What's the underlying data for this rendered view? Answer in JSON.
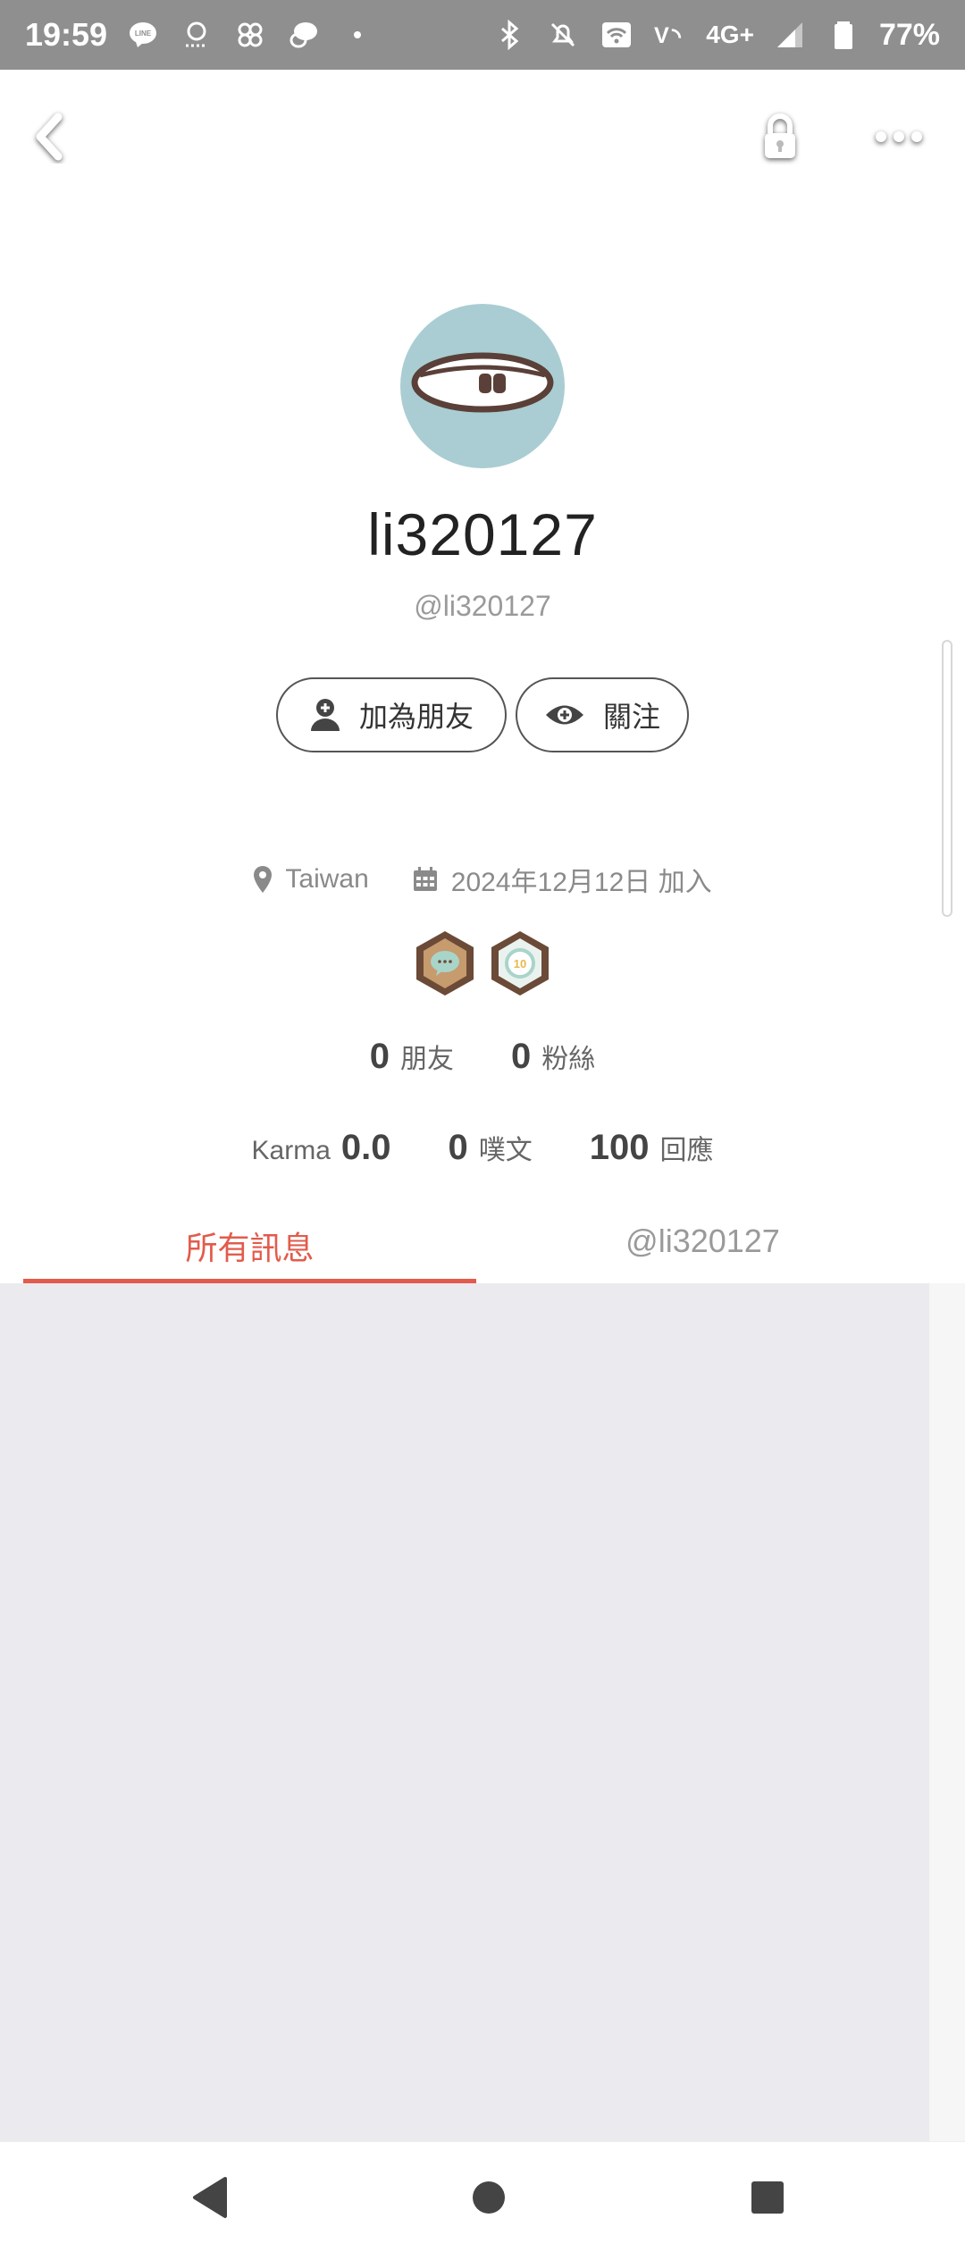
{
  "status_bar": {
    "time": "19:59",
    "network": "4G+",
    "battery": "77%"
  },
  "profile": {
    "display_name": "li320127",
    "handle": "@li320127",
    "location": "Taiwan",
    "joined": "2024年12月12日 加入"
  },
  "actions": {
    "add_friend": "加為朋友",
    "follow": "關注"
  },
  "badges": {
    "badge2_text": "10"
  },
  "stats": {
    "friends_count": "0",
    "friends_label": "朋友",
    "fans_count": "0",
    "fans_label": "粉絲",
    "karma_label": "Karma",
    "karma_value": "0.0",
    "posts_count": "0",
    "posts_label": "噗文",
    "replies_count": "100",
    "replies_label": "回應"
  },
  "tabs": [
    {
      "label": "所有訊息",
      "active": true
    },
    {
      "label": "@li320127",
      "active": false
    }
  ],
  "colors": {
    "accent": "#e25b4c",
    "avatar_bg": "#a9cdd2",
    "content_bg": "#ebeaee"
  }
}
